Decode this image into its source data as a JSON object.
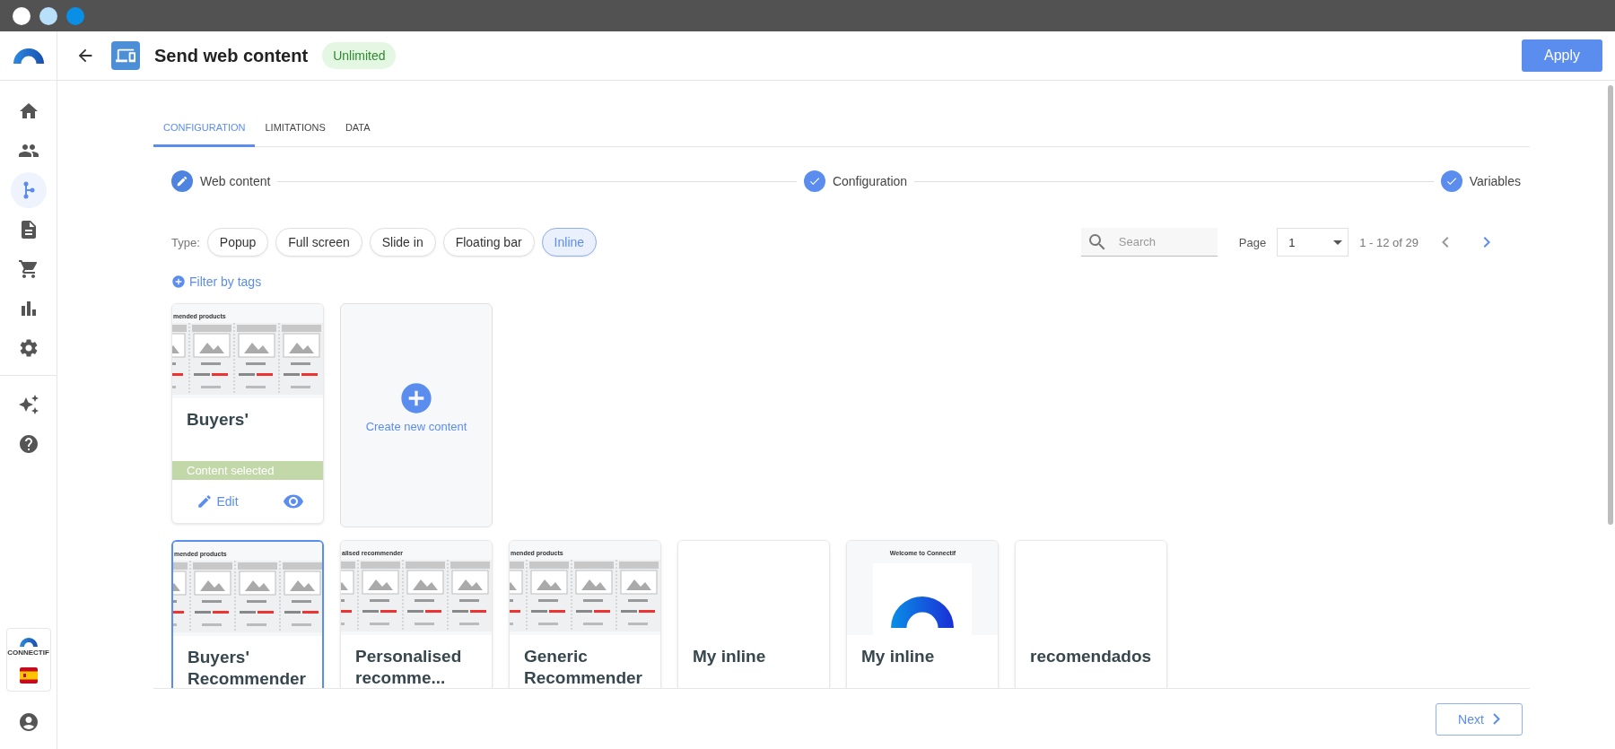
{
  "window": {
    "controls": [
      {
        "color": "#ffffff"
      },
      {
        "color": "#b8e0fa"
      },
      {
        "color": "#0a8fe6"
      }
    ]
  },
  "sidebar": {
    "items": [
      {
        "kind": "home",
        "selected": false
      },
      {
        "kind": "people",
        "selected": false
      },
      {
        "kind": "flow",
        "selected": true
      },
      {
        "kind": "document",
        "selected": false
      },
      {
        "kind": "cart",
        "selected": false
      },
      {
        "kind": "chart",
        "selected": false
      },
      {
        "kind": "settings",
        "selected": false
      }
    ],
    "extras": [
      {
        "kind": "sparkle"
      },
      {
        "kind": "help"
      }
    ],
    "brand": "CONNECTIF"
  },
  "header": {
    "title": "Send web content",
    "badge": "Unlimited",
    "apply": "Apply"
  },
  "tabs": [
    {
      "label": "CONFIGURATION",
      "selected": true
    },
    {
      "label": "LIMITATIONS",
      "selected": false
    },
    {
      "label": "DATA",
      "selected": false
    }
  ],
  "steps": [
    {
      "label": "Web content",
      "completed": false
    },
    {
      "label": "Configuration",
      "completed": true
    },
    {
      "label": "Variables",
      "completed": true
    }
  ],
  "type_filter": {
    "label": "Type:",
    "options": [
      {
        "label": "Popup",
        "selected": false
      },
      {
        "label": "Full screen",
        "selected": false
      },
      {
        "label": "Slide in",
        "selected": false
      },
      {
        "label": "Floating bar",
        "selected": false
      },
      {
        "label": "Inline",
        "selected": true
      }
    ]
  },
  "filter_by_tags": "Filter by tags",
  "search": {
    "placeholder": "Search"
  },
  "pagination": {
    "label": "Page",
    "page": "1",
    "range": "1 - 12 of 29",
    "previous": {
      "disabled": true
    },
    "next": {
      "disabled": false
    }
  },
  "selected_content": {
    "thumbnail": {
      "kind": "products",
      "caption": "mended products"
    },
    "title": "Buyers'",
    "status": "Content selected",
    "edit": "Edit"
  },
  "create_card": {
    "label": "Create new content"
  },
  "contents": [
    {
      "title": "Buyers' Recommender",
      "selected": true,
      "thumbnail": {
        "kind": "products",
        "caption": "mended products"
      }
    },
    {
      "title": "Personalised recomme...",
      "selected": false,
      "thumbnail": {
        "kind": "products",
        "caption": "alised recommender"
      }
    },
    {
      "title": "Generic Recommender",
      "selected": false,
      "thumbnail": {
        "kind": "products",
        "caption": "mended products"
      }
    },
    {
      "title": "My inline",
      "selected": false,
      "thumbnail": {
        "kind": "blank"
      }
    },
    {
      "title": "My inline",
      "selected": false,
      "thumbnail": {
        "kind": "logo",
        "caption": "Welcome to Connectif"
      }
    },
    {
      "title": "recomendados",
      "selected": false,
      "thumbnail": {
        "kind": "blank"
      }
    }
  ],
  "footer": {
    "next": "Next"
  }
}
